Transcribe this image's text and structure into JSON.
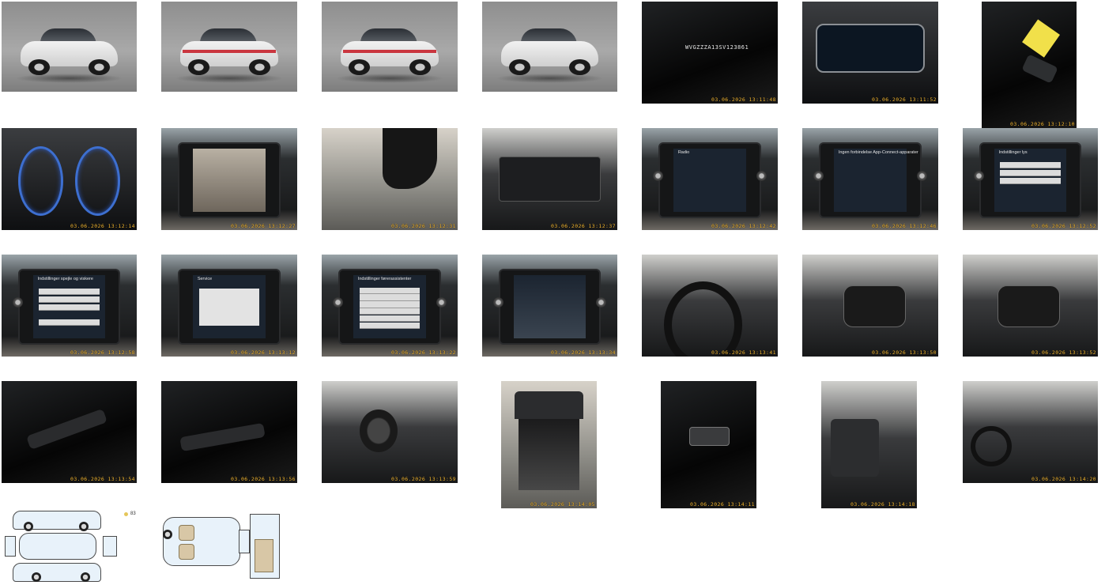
{
  "gallery": {
    "vin_text": "WVGZZZA13SV123861",
    "timestamps": [
      "03.06.2026 13:11:48",
      "03.06.2026 13:11:52",
      "03.06.2026 13:12:10",
      "03.06.2026 13:12:14",
      "03.06.2026 13:12:27",
      "03.06.2026 13:12:31",
      "03.06.2026 13:12:37",
      "03.06.2026 13:12:42",
      "03.06.2026 13:12:46",
      "03.06.2026 13:12:52",
      "03.06.2026 13:12:58",
      "03.06.2026 13:13:12",
      "03.06.2026 13:13:22",
      "03.06.2026 13:13:34",
      "03.06.2026 13:13:41",
      "03.06.2026 13:13:50",
      "03.06.2026 13:13:52",
      "03.06.2026 13:13:54",
      "03.06.2026 13:13:56",
      "03.06.2026 13:13:59",
      "03.06.2026 13:14:05",
      "03.06.2026 13:14:11",
      "03.06.2026 13:14:18",
      "03.06.2026 13:14:20"
    ],
    "screen_titles": {
      "mirrors": "Indstillinger spejle og viskere",
      "service": "Service",
      "assist": "Indstillinger førerassistenter",
      "lights": "Indstillinger lys",
      "appconnect": "Ingen forbindelse App-Connect-apparater",
      "radio": "Radio"
    },
    "diagram_legend": "83"
  }
}
